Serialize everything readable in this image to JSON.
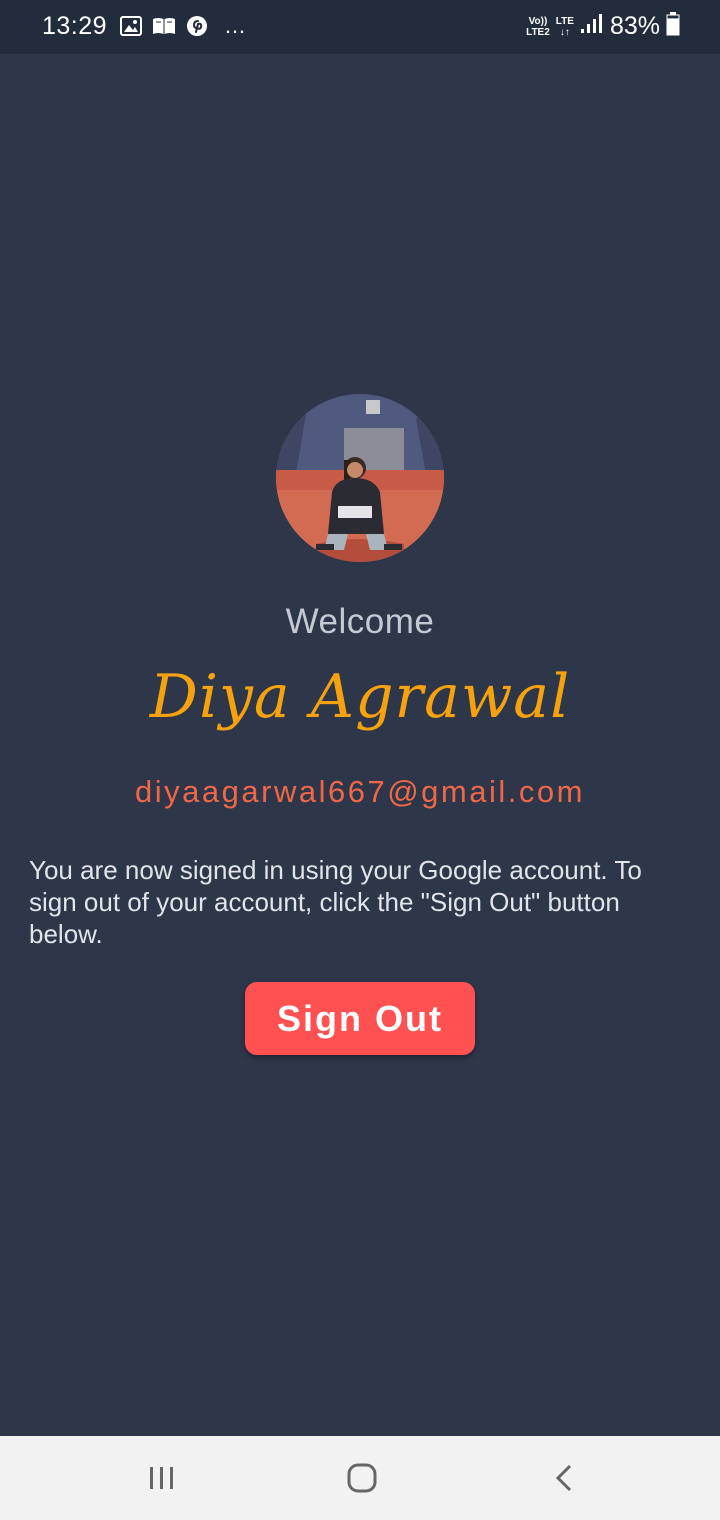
{
  "status_bar": {
    "time": "13:29",
    "left_icons": [
      "gallery-icon",
      "book-icon",
      "pinterest-icon"
    ],
    "more": "…",
    "network_top": "Vo)) LTE",
    "network_left_top": "Vo))",
    "network_left_bottom": "LTE2",
    "network_right_top": "LTE",
    "network_right_bottom": "↓↑",
    "battery_percent": "83%",
    "battery_level": 0.83
  },
  "profile": {
    "welcome": "Welcome",
    "name": "Diya Agrawal",
    "email": "diyaagarwal667@gmail.com",
    "message": "You are now signed in using your Google account. To sign out of your account, click the \"Sign Out\" button below."
  },
  "actions": {
    "sign_out_label": "Sign Out"
  },
  "nav_bar": {
    "icons": [
      "recent-apps-icon",
      "home-icon",
      "back-icon"
    ]
  },
  "colors": {
    "background": "#2e3649",
    "status_bar": "#232c3c",
    "name": "#f5a20e",
    "email": "#ef6747",
    "button": "#ff5151",
    "nav_bar": "#f2f2f2"
  }
}
